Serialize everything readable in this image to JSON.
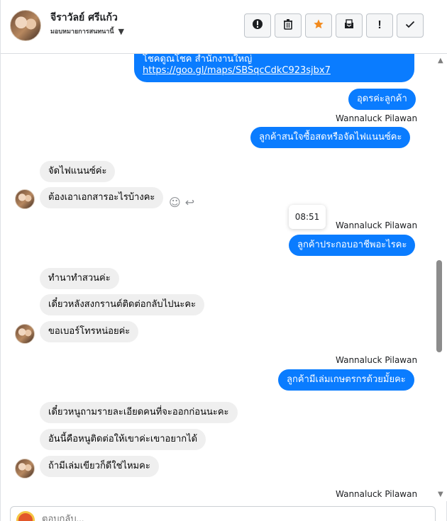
{
  "header": {
    "contact_name": "จีราวัลย์ ศรีแก้ว",
    "status_label": "มอบหมายการสนทนานี้",
    "actions": [
      {
        "icon": "alert-circle-icon",
        "glyph": "❗"
      },
      {
        "icon": "trash-icon",
        "glyph": "🗑"
      },
      {
        "icon": "star-icon",
        "glyph": "★"
      },
      {
        "icon": "archive-icon",
        "glyph": "🗳"
      },
      {
        "icon": "exclamation-icon",
        "glyph": "!"
      },
      {
        "icon": "check-icon",
        "glyph": "✓"
      }
    ]
  },
  "chat": {
    "messages": [
      {
        "dir": "out",
        "text_line1": "โชคดูณโชค สำนักงานใหญ่",
        "link": "https://goo.gl/maps/SBSqcCdkC923sjbx7"
      },
      {
        "dir": "out",
        "text": "อุดรค่ะลูกค้า"
      },
      {
        "sender": "Wannaluck Pilawan"
      },
      {
        "dir": "out",
        "text": "ลูกค้าสนใจซื้อสดหรือจัดไฟแนนซ์คะ"
      },
      {
        "dir": "in",
        "text": "จัดไฟแนนซ์ค่ะ"
      },
      {
        "dir": "in",
        "text": "ต้องเอาเอกสารอะไรบ้างคะ"
      },
      {
        "tooltip": "08:51"
      },
      {
        "sender": "Wannaluck Pilawan"
      },
      {
        "dir": "out",
        "text": "ลูกค้าประกอบอาชีพอะไรคะ"
      },
      {
        "dir": "in",
        "text": "ทำนาทำสวนค่ะ"
      },
      {
        "dir": "in",
        "text": "เดี๋ยวหลังสงกรานต์ติดต่อกลับไปนะคะ"
      },
      {
        "dir": "in",
        "text": "ขอเบอร์โทรหน่อยค่ะ"
      },
      {
        "sender": "Wannaluck Pilawan"
      },
      {
        "dir": "out",
        "text": "ลูกค้ามีเล่มเกษตรกรด้วยมั้ยคะ"
      },
      {
        "dir": "in",
        "text": "เดี๋ยวหนูถามรายละเอียดคนที่จะออกก่อนนะคะ"
      },
      {
        "dir": "in",
        "text": "อันนี้คือหนูติดต่อให้เขาค่ะเขาอยากได้"
      },
      {
        "dir": "in",
        "text": "ถ้ามีเล่มเขียวก็ดีใช่ไหมคะ"
      },
      {
        "sender": "Wannaluck Pilawan"
      }
    ]
  },
  "composer": {
    "placeholder": "ตอบกลับ..."
  }
}
